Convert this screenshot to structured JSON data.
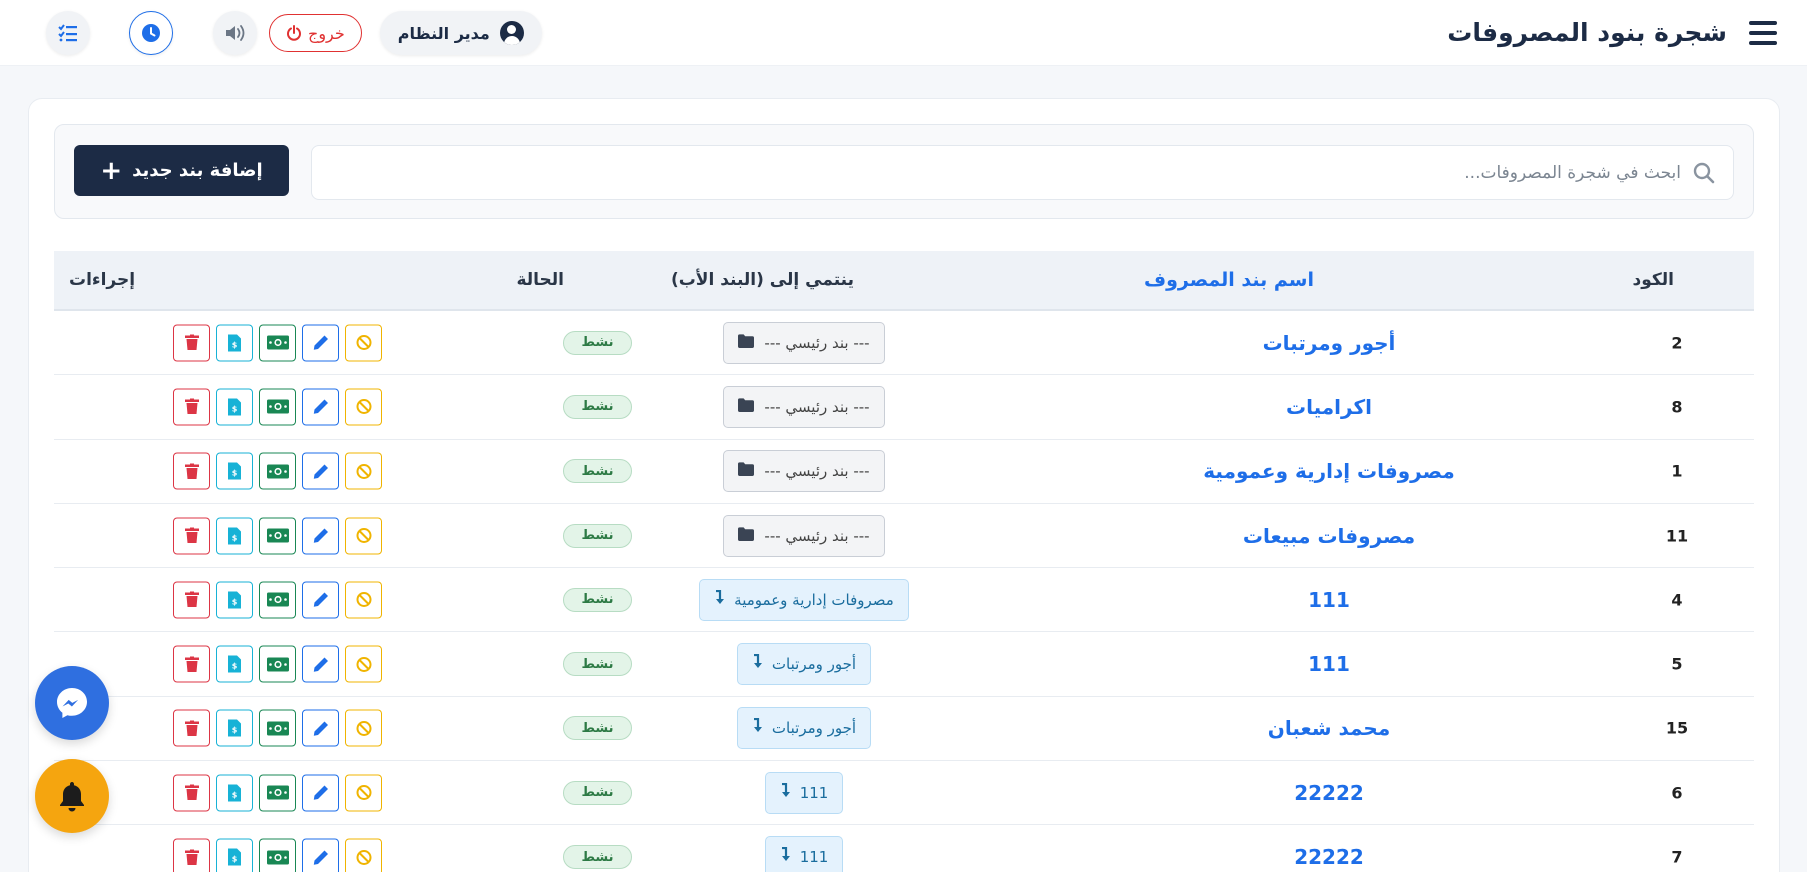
{
  "header": {
    "title": "شجرة بنود المصروفات",
    "user_label": "مدير النظام",
    "logout_label": "خروج"
  },
  "search": {
    "placeholder": "ابحث في شجرة المصروفات...",
    "add_label": "إضافة بند جديد"
  },
  "table": {
    "columns": {
      "code": "الكود",
      "name": "اسم بند المصروف",
      "parent": "ينتمي إلى (البند الأب)",
      "status": "الحالة",
      "actions": "إجراءات"
    },
    "rows": [
      {
        "code": "2",
        "name": "أجور ومرتبات",
        "parent": "--- بند رئيسي ---",
        "parent_type": "main",
        "status": "نشط"
      },
      {
        "code": "8",
        "name": "اكراميات",
        "parent": "--- بند رئيسي ---",
        "parent_type": "main",
        "status": "نشط"
      },
      {
        "code": "1",
        "name": "مصروفات إدارية وعمومية",
        "parent": "--- بند رئيسي ---",
        "parent_type": "main",
        "status": "نشط"
      },
      {
        "code": "11",
        "name": "مصروفات مبيعات",
        "parent": "--- بند رئيسي ---",
        "parent_type": "main",
        "status": "نشط"
      },
      {
        "code": "4",
        "name": "111",
        "parent": "مصروفات إدارية وعمومية",
        "parent_type": "child",
        "status": "نشط"
      },
      {
        "code": "5",
        "name": "111",
        "parent": "أجور ومرتبات",
        "parent_type": "child",
        "status": "نشط"
      },
      {
        "code": "15",
        "name": "محمد شعبان",
        "parent": "أجور ومرتبات",
        "parent_type": "child",
        "status": "نشط"
      },
      {
        "code": "6",
        "name": "22222",
        "parent": "111",
        "parent_type": "child",
        "status": "نشط"
      },
      {
        "code": "7",
        "name": "22222",
        "parent": "111",
        "parent_type": "child",
        "status": "نشط"
      }
    ]
  },
  "colors": {
    "primary": "#1c2b45",
    "link": "#1e6ee8",
    "danger": "#dc3545",
    "success": "#198754",
    "info": "#17b2d6",
    "warning": "#f0b400"
  }
}
